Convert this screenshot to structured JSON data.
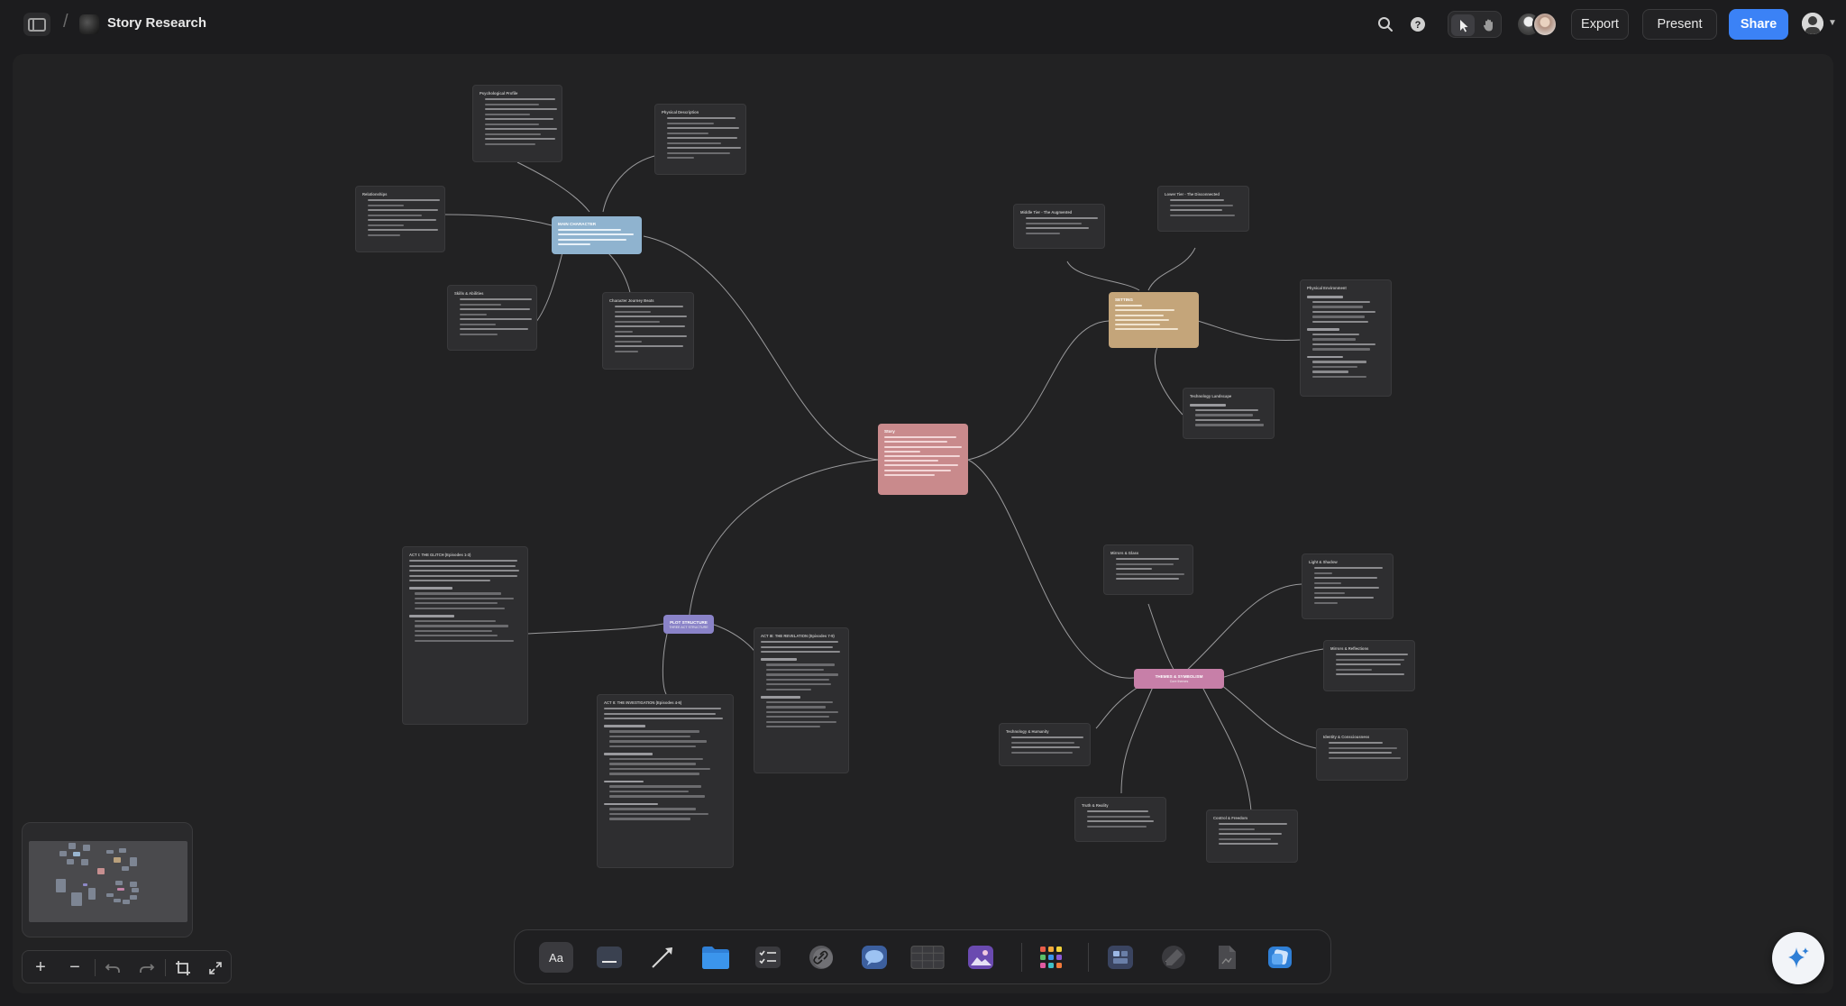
{
  "header": {
    "separator": "/",
    "title": "Story Research",
    "export_label": "Export",
    "present_label": "Present",
    "share_label": "Share"
  },
  "colors": {
    "central_node": "#c98a8c",
    "character_node": "#8fb3cf",
    "setting_node": "#c4a57a",
    "plot_node": "#8a83c8",
    "themes_node": "#c77fa8",
    "share_blue": "#3b82f6",
    "canvas_bg": "#222223"
  },
  "nodes": {
    "plot_label_1": "PLOT STRUCTURE",
    "plot_label_2": "THREE ACT STRUCTURE",
    "themes_label_1": "THEMES & SYMBOLISM",
    "themes_label_2": "Core themes",
    "character_title": "MAIN CHARACTER",
    "setting_title": "SETTING",
    "central_title": "Story"
  },
  "cards": {
    "psych_title": "Psychological Profile",
    "physical_title": "Physical Description",
    "relationships_title": "Relationships",
    "skills_title": "Skills & Abilities",
    "journey_title": "Character Journey Beats",
    "middle_tier_title": "Middle Tier - The Augmented",
    "lower_tier_title": "Lower Tier - The Disconnected",
    "physical_env_title": "Physical Environment",
    "tech_landscape_title": "Technology Landscape",
    "act1_title": "ACT I: THE GLITCH (Episodes 1-3)",
    "act2_title": "ACT II: THE INVESTIGATION (Episodes 4-6)",
    "act3_title": "ACT III: THE REVELATION (Episodes 7-9)",
    "mirrors_title": "Mirrors & Glass",
    "light_title": "Light & Shadow",
    "mirrors_reflections_title": "Mirrors & Reflections",
    "identity_title": "Identity & Consciousness",
    "tech_humanity_title": "Technology & Humanity",
    "truth_title": "Truth & Reality",
    "control_title": "Control & Freedom"
  },
  "minimap": {
    "label": "minimap"
  },
  "zoom": {
    "in": "+",
    "out": "−"
  },
  "dock": {
    "text_tool": "Aa"
  },
  "icons": [
    "sidebar-toggle-icon",
    "search-icon",
    "help-icon",
    "pointer-icon",
    "hand-icon",
    "export",
    "present",
    "share",
    "text-icon",
    "sticky-icon",
    "arrow-icon",
    "folder-icon",
    "checklist-icon",
    "link-icon",
    "comment-icon",
    "table-icon",
    "image-icon",
    "apps-icon",
    "frame-icon",
    "pen-icon",
    "doc-icon",
    "shapes-icon",
    "ai-sparkle-icon"
  ]
}
